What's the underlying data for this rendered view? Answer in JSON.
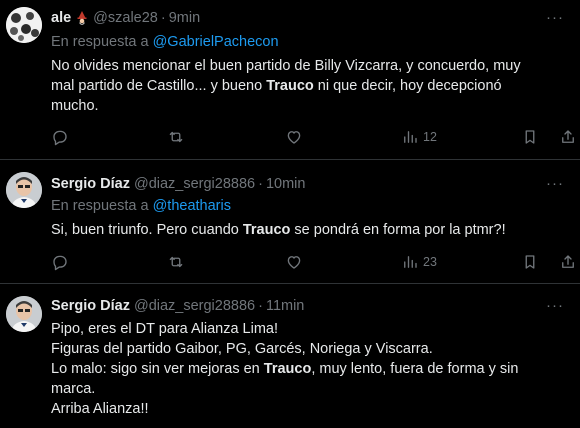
{
  "tweets": [
    {
      "name": "ale",
      "emoji": "🧙",
      "handle": "@szale28",
      "dot": "·",
      "time": "9min",
      "reply_prefix": "En respuesta a",
      "reply_to": "@GabrielPachecon",
      "body_lines": [
        [
          "No olvides mencionar el buen partido de Billy Vizcarra, y concuerdo, muy"
        ],
        [
          "mal partido de Castillo... y bueno ",
          "Trauco",
          " ni que decir, hoy decepcionó"
        ],
        [
          "mucho."
        ]
      ],
      "views": "12"
    },
    {
      "name": "Sergio Díaz",
      "handle": "@diaz_sergi28886",
      "dot": "·",
      "time": "10min",
      "reply_prefix": "En respuesta a",
      "reply_to": "@theatharis",
      "body_lines": [
        [
          "Si, buen triunfo. Pero cuando ",
          "Trauco",
          " se pondrá en forma por la ptmr?!"
        ]
      ],
      "views": "23"
    },
    {
      "name": "Sergio Díaz",
      "handle": "@diaz_sergi28886",
      "dot": "·",
      "time": "11min",
      "body_lines": [
        [
          "Pipo, eres el DT para Alianza Lima!"
        ],
        [
          "Figuras del partido Gaibor, PG, Garcés, Noriega y Viscarra."
        ],
        [
          "Lo malo: sigo sin ver mejoras en ",
          "Trauco",
          ", muy lento, fuera de forma y sin"
        ],
        [
          "marca."
        ],
        [
          "Arriba Alianza!!"
        ]
      ]
    }
  ],
  "more_label": "···",
  "icons": {
    "reply": "reply-icon",
    "retweet": "retweet-icon",
    "like": "like-icon",
    "views": "views-icon"
  },
  "colors": {
    "background": "#000000",
    "text": "#e7e9ea",
    "muted": "#71767b",
    "link": "#1d9bf0",
    "divider": "#2f3336"
  }
}
